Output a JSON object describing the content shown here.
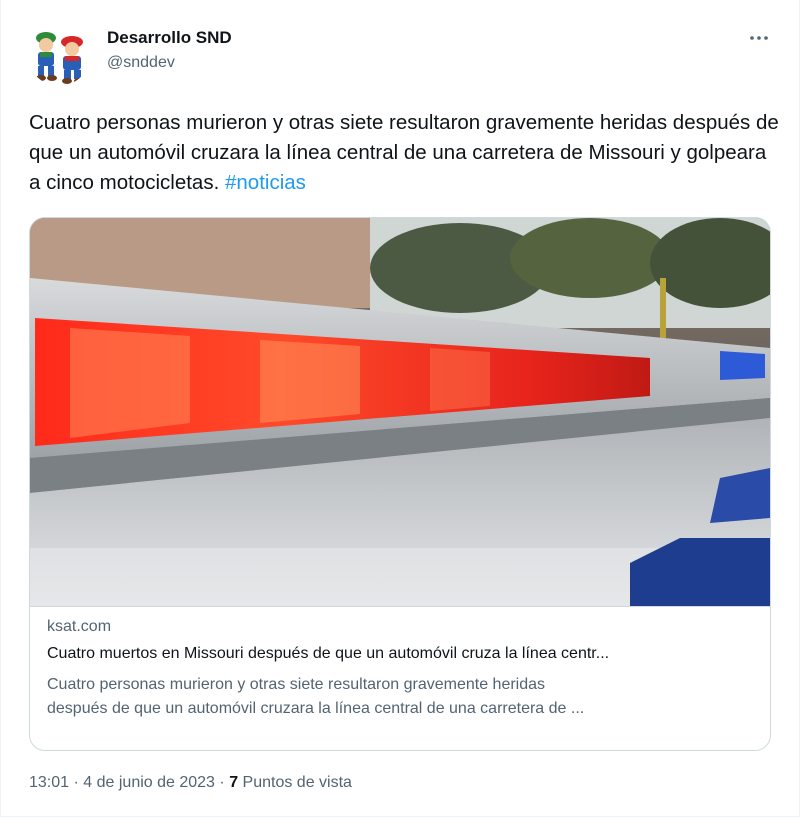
{
  "author": {
    "name": "Desarrollo SND",
    "handle": "@snddev",
    "avatar_icon": "cartoon-characters-avatar"
  },
  "more_icon": "more-horizontal-icon",
  "tweet": {
    "text": "Cuatro personas murieron y otras siete resultaron gravemente heridas después de que un automóvil cruzara la línea central de una carretera de Missouri y golpeara a cinco motocicletas.",
    "hashtag": "#noticias"
  },
  "link_card": {
    "image_desc": "police-car-emergency-light-bar",
    "domain": "ksat.com",
    "title": "Cuatro muertos en Missouri después de que un automóvil cruza la línea centr...",
    "description_line1": "Cuatro personas murieron y otras siete resultaron gravemente heridas",
    "description_line2": "después de que un automóvil cruzara la línea central de una carretera de ..."
  },
  "footer": {
    "time": "13:01",
    "separator": "·",
    "date": "4 de junio de 2023",
    "views_count": "7",
    "views_label": "Puntos de vista"
  },
  "colors": {
    "text": "#0f1419",
    "secondary": "#536471",
    "link": "#1d9bf0",
    "border": "#cfd9de"
  }
}
